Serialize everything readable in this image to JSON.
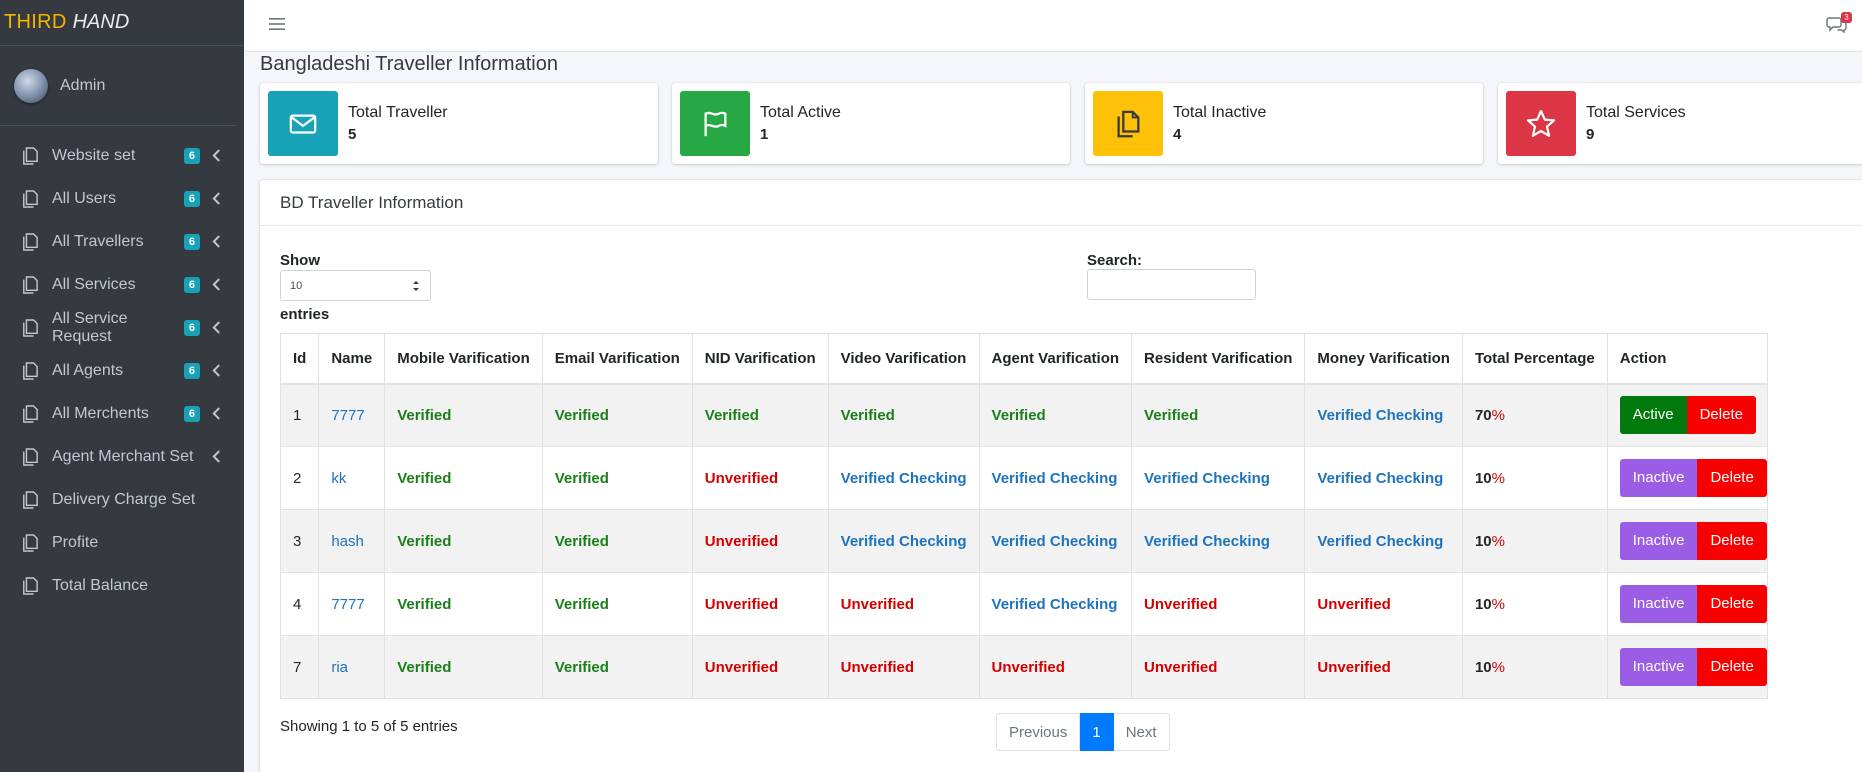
{
  "brand": {
    "part1": "THIRD",
    "part2": "HAND"
  },
  "user": {
    "name": "Admin"
  },
  "sidebar": {
    "items": [
      {
        "label": "Website set",
        "badge": "6",
        "has_chevron": true
      },
      {
        "label": "All Users",
        "badge": "6",
        "has_chevron": true
      },
      {
        "label": "All Travellers",
        "badge": "6",
        "has_chevron": true
      },
      {
        "label": "All Services",
        "badge": "6",
        "has_chevron": true
      },
      {
        "label": "All Service Request",
        "badge": "6",
        "has_chevron": true
      },
      {
        "label": "All Agents",
        "badge": "6",
        "has_chevron": true
      },
      {
        "label": "All Merchents",
        "badge": "6",
        "has_chevron": true
      },
      {
        "label": "Agent Merchant Set",
        "badge": "",
        "has_chevron": true
      },
      {
        "label": "Delivery Charge Set",
        "badge": "",
        "has_chevron": false
      },
      {
        "label": "Profite",
        "badge": "",
        "has_chevron": false
      },
      {
        "label": "Total Balance",
        "badge": "",
        "has_chevron": false
      }
    ]
  },
  "topbar": {
    "message_count": "3"
  },
  "page": {
    "title": "Bangladeshi Traveller Information"
  },
  "info_boxes": [
    {
      "label": "Total Traveller",
      "value": "5",
      "color": "#17a2b8",
      "icon": "envelope-icon"
    },
    {
      "label": "Total Active",
      "value": "1",
      "color": "#28a745",
      "icon": "flag-icon"
    },
    {
      "label": "Total Inactive",
      "value": "4",
      "color": "#ffc107",
      "icon": "copy-icon"
    },
    {
      "label": "Total Services",
      "value": "9",
      "color": "#dc3545",
      "icon": "star-icon"
    }
  ],
  "card": {
    "title": "BD Traveller Information"
  },
  "controls": {
    "show_label": "Show",
    "show_value": "10",
    "entries_label": "entries",
    "search_label": "Search:",
    "search_value": ""
  },
  "table": {
    "columns": [
      "Id",
      "Name",
      "Mobile Varification",
      "Email Varification",
      "NID Varification",
      "Video Varification",
      "Agent Varification",
      "Resident Varification",
      "Money Varification",
      "Total Percentage",
      "Action"
    ],
    "rows": [
      {
        "id": "1",
        "name": "7777",
        "mobile": "Verified",
        "email": "Verified",
        "nid": "Verified",
        "video": "Verified",
        "agent": "Verified",
        "resident": "Verified",
        "money": "Verified Checking",
        "percent": "70",
        "action": "Active"
      },
      {
        "id": "2",
        "name": "kk",
        "mobile": "Verified",
        "email": "Verified",
        "nid": "Unverified",
        "video": "Verified Checking",
        "agent": "Verified Checking",
        "resident": "Verified Checking",
        "money": "Verified Checking",
        "percent": "10",
        "action": "Inactive"
      },
      {
        "id": "3",
        "name": "hash",
        "mobile": "Verified",
        "email": "Verified",
        "nid": "Unverified",
        "video": "Verified Checking",
        "agent": "Verified Checking",
        "resident": "Verified Checking",
        "money": "Verified Checking",
        "percent": "10",
        "action": "Inactive"
      },
      {
        "id": "4",
        "name": "7777",
        "mobile": "Verified",
        "email": "Verified",
        "nid": "Unverified",
        "video": "Unverified",
        "agent": "Verified Checking",
        "resident": "Unverified",
        "money": "Unverified",
        "percent": "10",
        "action": "Inactive"
      },
      {
        "id": "7",
        "name": "ria",
        "mobile": "Verified",
        "email": "Verified",
        "nid": "Unverified",
        "video": "Unverified",
        "agent": "Unverified",
        "resident": "Unverified",
        "money": "Unverified",
        "percent": "10",
        "action": "Inactive"
      }
    ],
    "percent_symbol": "%",
    "delete_label": "Delete"
  },
  "footer": {
    "showing": "Showing 1 to 5 of 5 entries",
    "prev": "Previous",
    "current": "1",
    "next": "Next"
  },
  "colors": {
    "verified": "#1a7f1a",
    "unverified": "#d40000",
    "checking": "#1e73be",
    "active_btn": "#007a0c",
    "inactive_btn": "#9b5de5",
    "delete_btn": "#f80000"
  }
}
